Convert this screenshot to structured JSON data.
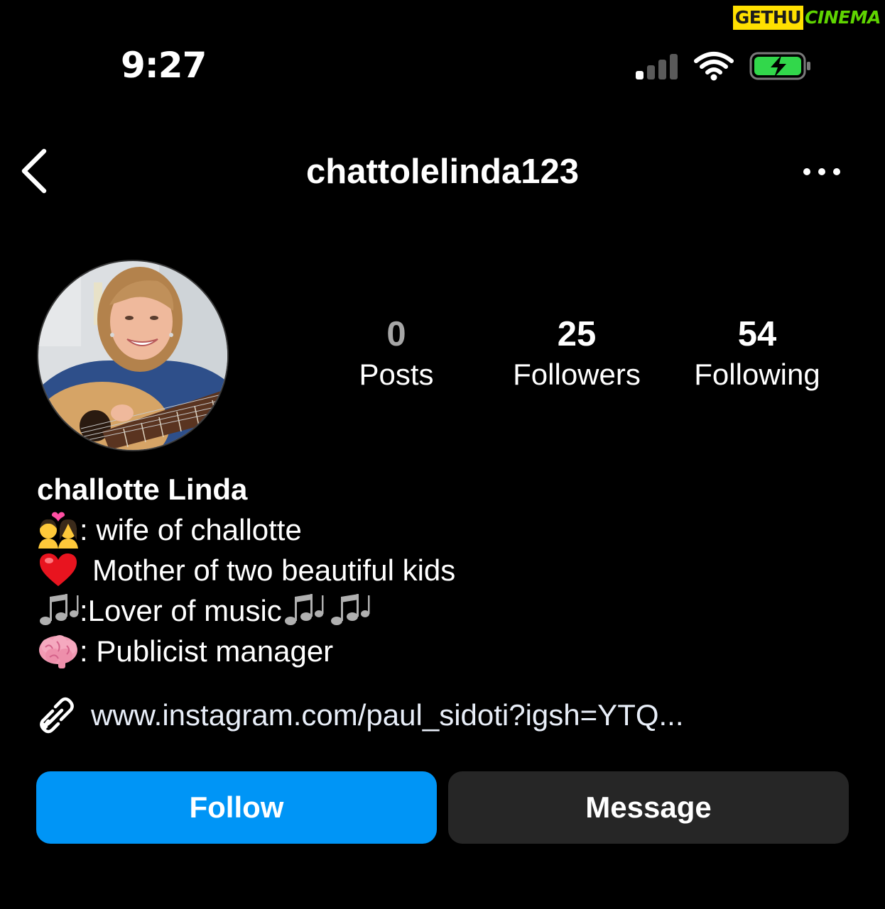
{
  "watermark": {
    "part1": "GETHU",
    "part2": "CINEMA",
    "color_part1_bg": "#ffe000",
    "color_part2": "#5fd400"
  },
  "status_bar": {
    "time": "9:27",
    "signal_icon": "cellular-signal-icon",
    "wifi_icon": "wifi-icon",
    "battery_icon": "battery-charging-icon",
    "battery_color": "#32d74b"
  },
  "header": {
    "back_icon": "chevron-left-icon",
    "username": "chattolelinda123",
    "more_icon": "more-horizontal-icon"
  },
  "profile": {
    "avatar_icon": "profile-photo",
    "stats": {
      "posts": {
        "value": "0",
        "label": "Posts"
      },
      "followers": {
        "value": "25",
        "label": "Followers"
      },
      "following": {
        "value": "54",
        "label": "Following"
      }
    },
    "bio": {
      "name": "challotte Linda",
      "lines": [
        {
          "icon": "couple-with-heart-icon",
          "text": ": wife of challotte"
        },
        {
          "icon": "red-heart-icon",
          "text": "Mother of two beautiful kids"
        },
        {
          "icon": "musical-notes-icon",
          "text": ":Lover of music "
        },
        {
          "icon": "brain-icon",
          "text": ": Publicist manager"
        }
      ]
    },
    "link": {
      "icon": "link-icon",
      "text": "www.instagram.com/paul_sidoti?igsh=YTQ..."
    }
  },
  "actions": {
    "follow_label": "Follow",
    "message_label": "Message",
    "follow_color": "#0095f6",
    "message_color": "#262626"
  }
}
